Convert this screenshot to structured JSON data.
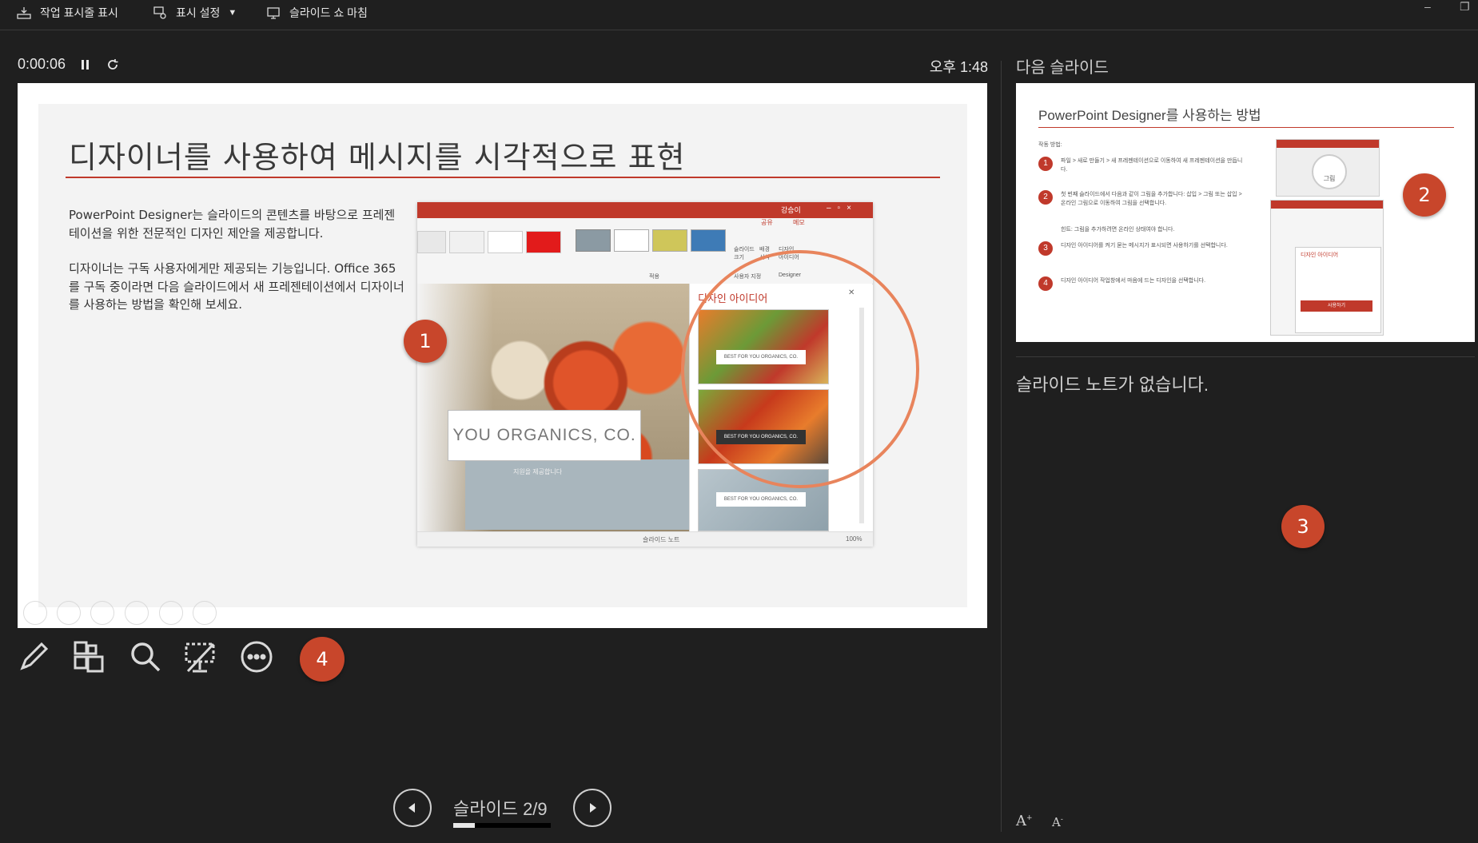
{
  "toolbar": {
    "show_taskbar": "작업 표시줄 표시",
    "display_settings": "표시 설정",
    "end_slideshow": "슬라이드 쇼 마침",
    "window_minimize": "‒"
  },
  "timer": {
    "elapsed": "0:00:06",
    "clock": "오후 1:48"
  },
  "current_slide": {
    "title": "디자이너를 사용하여 메시지를 시각적으로 표현",
    "paragraph1": "PowerPoint Designer는 슬라이드의 콘텐츠를 바탕으로 프레젠테이션을 위한 전문적인 디자인 제안을 제공합니다.",
    "paragraph2": "디자이너는 구독 사용자에게만 제공되는 기능입니다. Office 365를 구독 중이라면 다음 슬라이드에서 새 프레젠테이션에서 디자이너를 사용하는 방법을 확인해 보세요.",
    "screenshot": {
      "titlebar_user": "강승이",
      "ribbon_share": "공유",
      "ribbon_memo": "메모",
      "ribbon_group_apply": "적용",
      "ribbon_group_user": "사용자 지정",
      "ribbon_group_designer": "Designer",
      "ribbon_btn_slide_size": "슬라이드 크기",
      "ribbon_btn_bg_format": "배경 서식",
      "ribbon_btn_design_ideas": "디자인 아이디어",
      "caption": "YOU ORGANICS, CO.",
      "band_text": "지원을 제공합니다",
      "pane_title": "디자인 아이디어",
      "thumb_label": "BEST FOR YOU ORGANICS, CO.",
      "status_notes": "슬라이드 노트",
      "status_zoom": "100%"
    },
    "markers": [
      "1",
      "4"
    ]
  },
  "next_slide": {
    "label": "다음 슬라이드",
    "title": "PowerPoint Designer를 사용하는 방법",
    "intro": "작동 방법:",
    "steps": [
      {
        "num": "1",
        "text": "파일 > 새로 만들기 > 새 프레젠테이션으로 이동하여 새 프레젠테이션을 만듭니다."
      },
      {
        "num": "2",
        "text": "첫 번째 슬라이드에서 다음과 같이 그림을 추가합니다: 삽입 > 그림 또는 삽입 > 온라인 그림으로 이동하여 그림을 선택합니다."
      },
      {
        "num": "3",
        "text": "디자인 아이디어를 켜기 묻는 메시지가 표시되면 사용하기를 선택합니다."
      },
      {
        "num": "4",
        "text": "디자인 아이디어 작업창에서 마음에 드는 디자인을 선택합니다."
      }
    ],
    "tip": "힌트: 그림을 추가하려면 온라인 상태여야 합니다.",
    "img_pane_title": "디자인 아이디어",
    "img_button": "사용하기",
    "img_circle_label": "그림",
    "marker": "2"
  },
  "notes": {
    "text": "슬라이드 노트가 없습니다.",
    "marker": "3",
    "font_increase": "A",
    "font_decrease": "A"
  },
  "navigation": {
    "counter": "슬라이드 2/9",
    "progress": 0.2222
  },
  "tool_icons": [
    "pen-icon",
    "slides-grid-icon",
    "zoom-icon",
    "black-screen-icon",
    "more-options-icon"
  ],
  "colors": {
    "accent": "#c0392b",
    "marker": "#c8462b",
    "background": "#1f1f1f"
  }
}
